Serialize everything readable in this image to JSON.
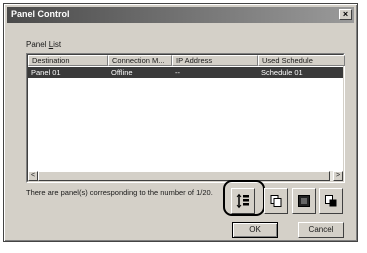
{
  "window": {
    "title": "Panel Control",
    "close_glyph": "×"
  },
  "panel_list": {
    "label_accel": "L",
    "label_prefix": "Panel ",
    "label_suffix": "ist",
    "columns": [
      "Destination",
      "Connection M...",
      "IP Address",
      "Used Schedule"
    ],
    "rows": [
      {
        "destination": "Panel 01",
        "connection": "Offline",
        "ip": "--",
        "schedule": "Schedule 01",
        "selected": true
      }
    ]
  },
  "status": {
    "text": "There are panel(s) corresponding to the number of 1/20."
  },
  "toolbar": {
    "buttons": [
      {
        "icon": "add-panel-icon"
      },
      {
        "icon": "copy-panel-icon"
      },
      {
        "icon": "panel-properties-icon"
      },
      {
        "icon": "transfer-panel-icon"
      }
    ]
  },
  "buttons": {
    "ok_label": "OK",
    "cancel_label": "Cancel"
  },
  "scrollbar": {
    "left_glyph": "<",
    "right_glyph": ">"
  }
}
